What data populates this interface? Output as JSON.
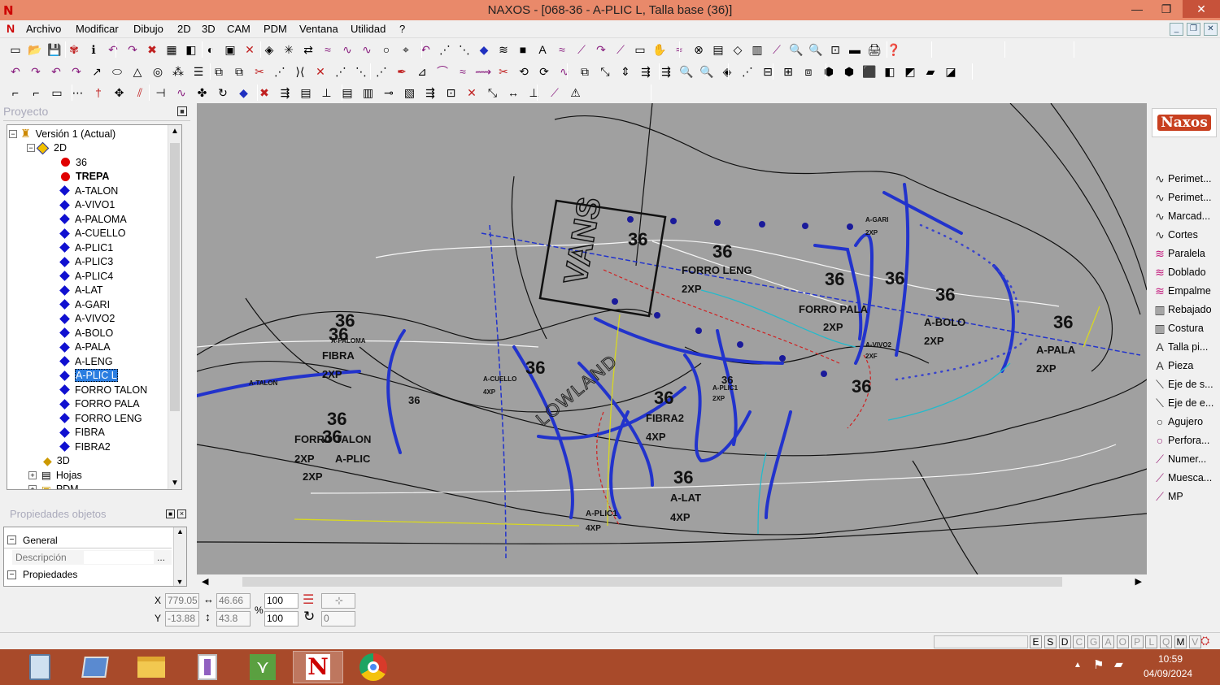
{
  "window": {
    "title": "NAXOS - [068-36 - A-PLIC L, Talla base (36)]",
    "minimize": "—",
    "restore": "❐",
    "close": "✕"
  },
  "menu": [
    "Archivo",
    "Modificar",
    "Dibujo",
    "2D",
    "3D",
    "CAM",
    "PDM",
    "Ventana",
    "Utilidad",
    "?"
  ],
  "project_panel": {
    "title": "Proyecto",
    "tree": [
      {
        "label": "Versión 1 (Actual)",
        "kind": "root"
      },
      {
        "label": "2D",
        "kind": "folder"
      },
      {
        "label": "36",
        "kind": "red"
      },
      {
        "label": "TREPA",
        "kind": "red",
        "bold": true
      },
      {
        "label": "A-TALON",
        "kind": "blue"
      },
      {
        "label": "A-VIVO1",
        "kind": "blue"
      },
      {
        "label": "A-PALOMA",
        "kind": "blue"
      },
      {
        "label": "A-CUELLO",
        "kind": "blue"
      },
      {
        "label": "A-PLIC1",
        "kind": "blue"
      },
      {
        "label": "A-PLIC3",
        "kind": "blue"
      },
      {
        "label": "A-PLIC4",
        "kind": "blue"
      },
      {
        "label": "A-LAT",
        "kind": "blue"
      },
      {
        "label": "A-GARI",
        "kind": "blue"
      },
      {
        "label": "A-VIVO2",
        "kind": "blue"
      },
      {
        "label": "A-BOLO",
        "kind": "blue"
      },
      {
        "label": "A-PALA",
        "kind": "blue"
      },
      {
        "label": "A-LENG",
        "kind": "blue"
      },
      {
        "label": "A-PLIC L",
        "kind": "blue",
        "selected": true
      },
      {
        "label": "FORRO TALON",
        "kind": "blue"
      },
      {
        "label": "FORRO PALA",
        "kind": "blue"
      },
      {
        "label": "FORRO LENG",
        "kind": "blue"
      },
      {
        "label": "FIBRA",
        "kind": "blue"
      },
      {
        "label": "FIBRA2",
        "kind": "blue"
      },
      {
        "label": "3D",
        "kind": "folder3d"
      },
      {
        "label": "Hojas",
        "kind": "sheets"
      },
      {
        "label": "PDM",
        "kind": "pdm"
      }
    ]
  },
  "properties_panel": {
    "title": "Propiedades objetos",
    "general": "General",
    "descripcion": "Descripción",
    "more": "...",
    "propiedades": "Propiedades"
  },
  "canvas_labels": {
    "sizes": [
      "36",
      "36",
      "36",
      "36",
      "36",
      "36",
      "36",
      "36",
      "36",
      "36",
      "36",
      "36",
      "36",
      "36",
      "36",
      "36"
    ],
    "pieces": [
      {
        "name": "FORRO LENG",
        "qty": "2XP"
      },
      {
        "name": "FORRO PALA",
        "qty": "2XP"
      },
      {
        "name": "A-BOLO",
        "qty": "2XP"
      },
      {
        "name": "A-PALA",
        "qty": "2XP"
      },
      {
        "name": "FIBRA",
        "qty": "2XP"
      },
      {
        "name": "FIBRA2",
        "qty": "4XP"
      },
      {
        "name": "FORRO TALON",
        "qty": "2XP"
      },
      {
        "name": "A-LAT",
        "qty": "4XP"
      },
      {
        "name": "A-PLIC1",
        "qty": "4XP"
      },
      {
        "name": "A-CUELLO",
        "qty": "4XP"
      },
      {
        "name": "A-GARI",
        "qty": "2XP"
      },
      {
        "name": "A-VIVO2",
        "qty": "2XF"
      },
      {
        "name": "A-PLIC1",
        "qty": "2XP"
      },
      {
        "name": "A-PALOMA",
        "qty": ""
      },
      {
        "name": "A-TALON",
        "qty": ""
      },
      {
        "name": "A-PLIC",
        "qty": "2XP"
      }
    ],
    "brand": "LOWLAND",
    "logo": "VANS"
  },
  "right_panel": {
    "brand": "Naxos",
    "tools": [
      "Perimet...",
      "Perimet...",
      "Marcad...",
      "Cortes",
      "Paralela",
      "Doblado",
      "Empalme",
      "Rebajado",
      "Costura",
      "Talla pi...",
      "Pieza",
      "Eje de s...",
      "Eje de e...",
      "Agujero",
      "Perfora...",
      "Numer...",
      "Muesca...",
      "MP"
    ]
  },
  "coords": {
    "x_label": "X",
    "y_label": "Y",
    "x": "779.05",
    "y": "-13.88",
    "width": "46.66",
    "height": "43.8",
    "percent_sign": "%",
    "scale_x": "100",
    "scale_y": "100",
    "rotation": "0"
  },
  "status_letters": [
    "E",
    "S",
    "D",
    "C",
    "G",
    "A",
    "O",
    "P",
    "L",
    "Q",
    "M",
    "V"
  ],
  "taskbar": {
    "time": "10:59",
    "date": "04/09/2024"
  },
  "colors": {
    "titlebar": "#e9896a",
    "taskbar": "#a84a2a",
    "canvas": "#a0a0a0",
    "selection": "#2a7de0"
  }
}
